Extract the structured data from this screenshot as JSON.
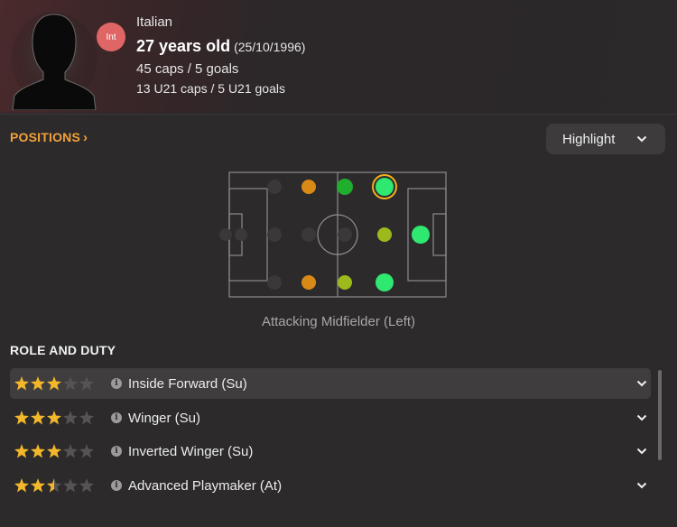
{
  "player": {
    "nationality": "Italian",
    "badge": "Int",
    "age": "27 years old",
    "dob": "(25/10/1996)",
    "caps": "45 caps / 5 goals",
    "u21": "13 U21 caps / 5 U21 goals"
  },
  "positions": {
    "title": "POSITIONS",
    "chevron": "›",
    "highlight_label": "Highlight",
    "selected_caption": "Attacking Midfielder (Left)",
    "legend_colors": {
      "natural": "#2ee870",
      "accomplished": "#1fae2e",
      "competent": "#9cba1c",
      "unconvincing": "#d98a16",
      "ineffectual": "#3a3839",
      "selected_ring": "#f2b01e"
    }
  },
  "role_and_duty": {
    "title": "ROLE AND DUTY",
    "roles": [
      {
        "label": "Inside Forward (Su)",
        "stars": 3,
        "selected": true
      },
      {
        "label": "Winger (Su)",
        "stars": 3,
        "selected": false
      },
      {
        "label": "Inverted Winger (Su)",
        "stars": 3,
        "selected": false
      },
      {
        "label": "Advanced Playmaker (At)",
        "stars": 2.5,
        "selected": false
      }
    ]
  }
}
